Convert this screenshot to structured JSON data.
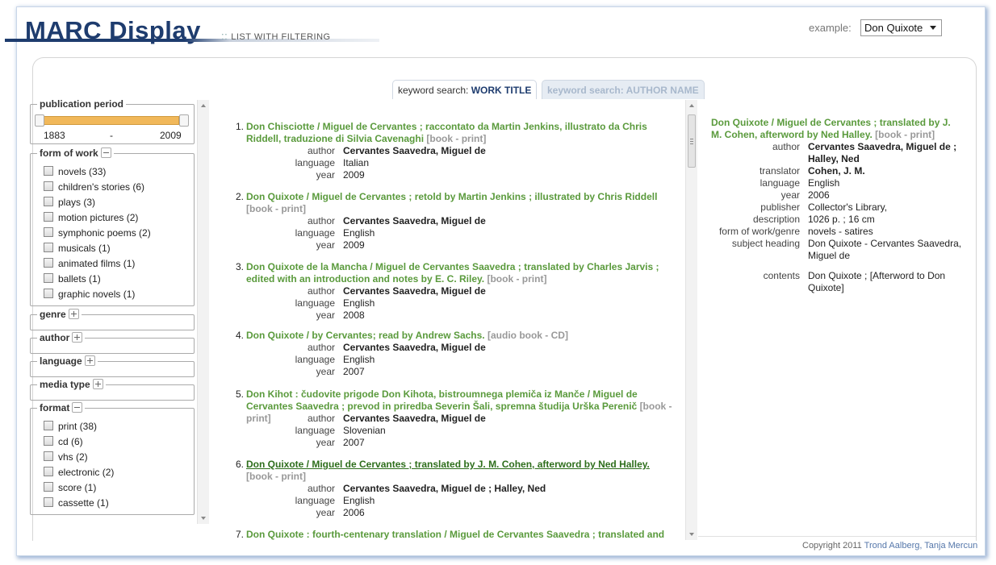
{
  "header": {
    "logo": "MARC Display",
    "subtitle_sep": "::",
    "subtitle": "LIST WITH FILTERING",
    "example_label": "example:",
    "example_selected": "Don Quixote"
  },
  "tabs": [
    {
      "prefix": "keyword search:",
      "label": "WORK TITLE",
      "active": true
    },
    {
      "prefix": "keyword search:",
      "label": "AUTHOR NAME",
      "active": false
    }
  ],
  "facets": {
    "publication_period": {
      "label": "publication period",
      "from": "1883",
      "dash": "-",
      "to": "2009"
    },
    "form_of_work": {
      "label": "form of work",
      "items": [
        "novels (33)",
        "children's stories (6)",
        "plays (3)",
        "motion pictures (2)",
        "symphonic poems (2)",
        "musicals (1)",
        "animated films (1)",
        "ballets (1)",
        "graphic novels (1)"
      ]
    },
    "genre": {
      "label": "genre"
    },
    "author": {
      "label": "author"
    },
    "language": {
      "label": "language"
    },
    "media_type": {
      "label": "media type"
    },
    "format": {
      "label": "format",
      "items": [
        "print (38)",
        "cd (6)",
        "vhs (2)",
        "electronic (2)",
        "score (1)",
        "cassette (1)"
      ]
    }
  },
  "results": [
    {
      "num": "1.",
      "title": "Don Chisciotte / Miguel de Cervantes ; raccontato da Martin Jenkins, illustrato da Chris Riddell, traduzione di Silvia Cavenaghi",
      "type": "[book - print]",
      "author_key": "author",
      "author": "Cervantes Saavedra, Miguel de",
      "language_key": "language",
      "language": "Italian",
      "year_key": "year",
      "year": "2009"
    },
    {
      "num": "2.",
      "title": "Don Quixote / Miguel de Cervantes ; retold by Martin Jenkins ; illustrated by Chris Riddell",
      "type": "[book - print]",
      "author_key": "author",
      "author": "Cervantes Saavedra, Miguel de",
      "language_key": "language",
      "language": "English",
      "year_key": "year",
      "year": "2009"
    },
    {
      "num": "3.",
      "title": "Don Quixote de la Mancha / Miguel de Cervantes Saavedra ; translated by Charles Jarvis ; edited with an introduction and notes by E. C. Riley.",
      "type": "[book - print]",
      "author_key": "author",
      "author": "Cervantes Saavedra, Miguel de",
      "language_key": "language",
      "language": "English",
      "year_key": "year",
      "year": "2008"
    },
    {
      "num": "4.",
      "title": "Don Quixote / by Cervantes; read by Andrew Sachs.",
      "type": "[audio book - CD]",
      "author_key": "author",
      "author": "Cervantes Saavedra, Miguel de",
      "language_key": "language",
      "language": "English",
      "year_key": "year",
      "year": "2007"
    },
    {
      "num": "5.",
      "title": "Don Kihot : čudovite prigode Don Kihota, bistroumnega plemiča iz Manče / Miguel de Cervantes Saavedra ; prevod in priredba Severin Šali, spremna študija Urška Perenič",
      "type": "[book - print]",
      "author_key": "author",
      "author": "Cervantes Saavedra, Miguel de",
      "language_key": "language",
      "language": "Slovenian",
      "year_key": "year",
      "year": "2007"
    },
    {
      "num": "6.",
      "title": "Don Quixote / Miguel de Cervantes ; translated by J. M. Cohen, afterword by Ned Halley.",
      "type": "[book - print]",
      "author_key": "author",
      "author": "Cervantes Saavedra, Miguel de ; Halley, Ned",
      "language_key": "language",
      "language": "English",
      "year_key": "year",
      "year": "2006"
    },
    {
      "num": "7.",
      "title": "Don Quixote : fourth-centenary translation / Miguel de Cervantes Saavedra ; translated and",
      "type": ""
    }
  ],
  "detail": {
    "title": "Don Quixote / Miguel de Cervantes ; translated by J. M. Cohen, afterword by Ned Halley.",
    "type": "[book - print]",
    "rows": [
      {
        "key": "author",
        "value": "Cervantes Saavedra, Miguel de ; Halley, Ned"
      },
      {
        "key": "translator",
        "value": "Cohen, J. M."
      },
      {
        "key": "language",
        "value": "English"
      },
      {
        "key": "year",
        "value": "2006"
      },
      {
        "key": "publisher",
        "value": "Collector's Library,"
      },
      {
        "key": "description",
        "value": "1026 p. ; 16 cm"
      },
      {
        "key": "form of work/genre",
        "value": "novels - satires"
      },
      {
        "key": "subject heading",
        "value": "Don Quixote - Cervantes Saavedra, Miguel de"
      },
      {
        "key": "contents",
        "value": "Don Quixote ; [Afterword to Don Quixote]"
      }
    ]
  },
  "footer": {
    "copyright": "Copyright 2011",
    "authors": "Trond Aalberg, Tanja Mercun"
  }
}
